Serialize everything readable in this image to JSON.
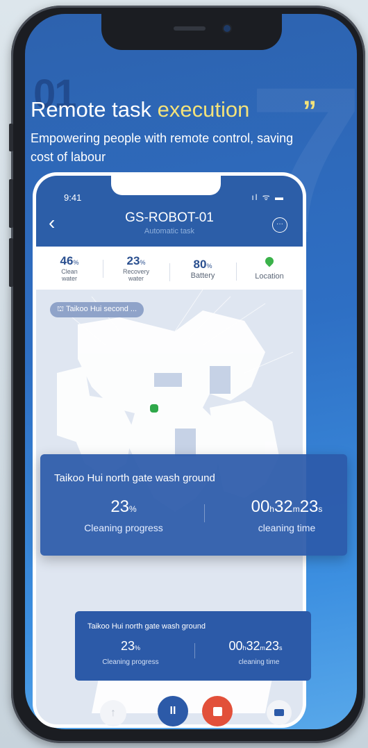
{
  "heading": {
    "number": "01",
    "title_part1": "Remote task ",
    "title_highlight": "execution",
    "quote_mark": "”",
    "subtitle": "Empowering people with remote  control, saving cost of labour"
  },
  "app": {
    "status_time": "9:41",
    "status_icons": "ıl ᯤ ▬",
    "title": "GS-ROBOT-01",
    "subtitle": "Automatic task",
    "stats": [
      {
        "value": "46",
        "unit": "%",
        "label": "Clean water"
      },
      {
        "value": "23",
        "unit": "%",
        "label": "Recovery water"
      },
      {
        "value": "80",
        "unit": "%",
        "label": "Battery"
      },
      {
        "label": "Location"
      }
    ],
    "map_chip": "Taikoo Hui second ..."
  },
  "task_card": {
    "title": "Taikoo Hui north gate wash ground",
    "progress_value": "23",
    "progress_unit": "%",
    "progress_label": "Cleaning progress",
    "time_h": "00",
    "time_m": "32",
    "time_s": "23",
    "time_label": "cleaning time"
  },
  "small_card": {
    "title": "Taikoo Hui north gate wash ground",
    "progress_value": "23",
    "progress_unit": "%",
    "progress_label": "Cleaning progress",
    "time_h": "00",
    "time_m": "32",
    "time_s": "23",
    "time_label": "cleaning time"
  },
  "controls": {
    "up_icon": "arrow-up-icon",
    "pause_icon": "pause-icon",
    "stop_icon": "stop-icon",
    "camera_icon": "video-camera-icon"
  },
  "colors": {
    "primary_blue": "#2c5aa8",
    "highlight_yellow": "#f3e27a",
    "stop_red": "#e2503a",
    "location_green": "#3bb24a"
  }
}
